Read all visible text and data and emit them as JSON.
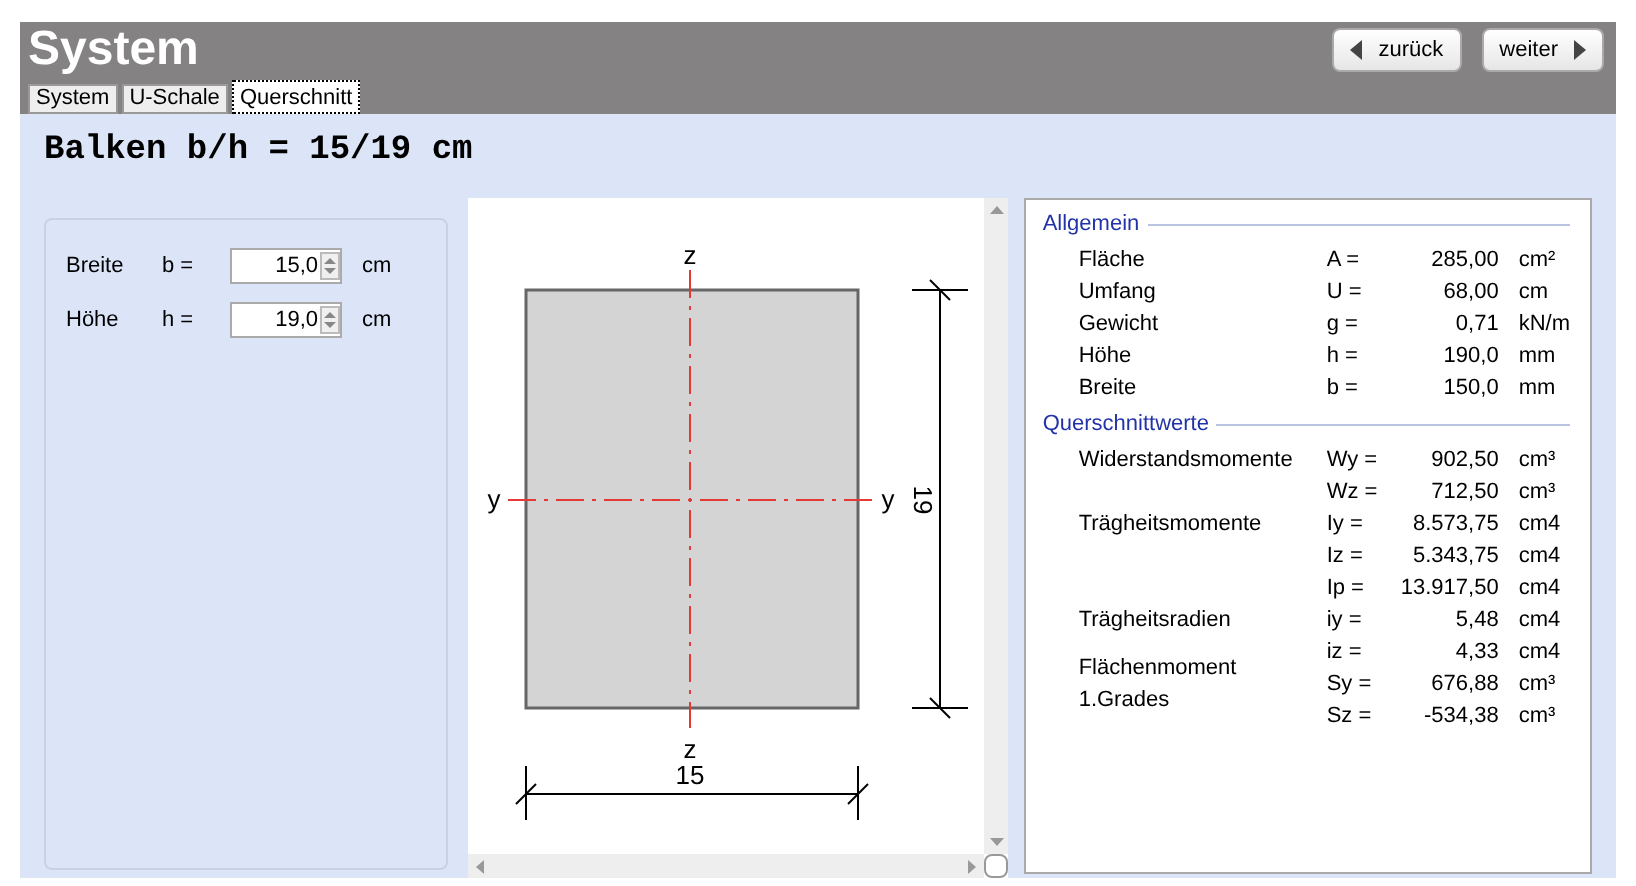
{
  "header": {
    "title": "System",
    "buttons": [
      {
        "kind": "back",
        "label": "zurück"
      },
      {
        "kind": "next",
        "label": "weiter"
      }
    ]
  },
  "tabs": [
    {
      "label": "System",
      "selected": false
    },
    {
      "label": "U-Schale",
      "selected": false
    },
    {
      "label": "Querschnitt",
      "selected": true
    }
  ],
  "heading": "Balken b/h = 15/19 cm",
  "inputs": [
    {
      "label": "Breite",
      "symbol": "b =",
      "value": "15,0",
      "unit": "cm"
    },
    {
      "label": "Höhe",
      "symbol": "h =",
      "value": "19,0",
      "unit": "cm"
    }
  ],
  "drawing": {
    "z_top": "z",
    "z_bottom": "z",
    "y_left": "y",
    "y_right": "y",
    "height_dimension": "19",
    "width_dimension": "15"
  },
  "results": [
    {
      "title": "Allgemein",
      "rows": [
        {
          "label": "Fläche",
          "symbol": "A =",
          "value": "285,00",
          "unit": "cm²"
        },
        {
          "label": "Umfang",
          "symbol": "U =",
          "value": "68,00",
          "unit": "cm"
        },
        {
          "label": "Gewicht",
          "symbol": "g =",
          "value": "0,71",
          "unit": "kN/m"
        },
        {
          "label": "Höhe",
          "symbol": "h =",
          "value": "190,0",
          "unit": "mm"
        },
        {
          "label": "Breite",
          "symbol": "b =",
          "value": "150,0",
          "unit": "mm"
        }
      ]
    },
    {
      "title": "Querschnittwerte",
      "rows": [
        {
          "label": "Widerstandsmomente",
          "symbol": "Wy =",
          "value": "902,50",
          "unit": "cm³"
        },
        {
          "symbol": "Wz =",
          "value": "712,50",
          "unit": "cm³"
        },
        {
          "label": "Trägheitsmomente",
          "symbol": "Iy =",
          "value": "8.573,75",
          "unit": "cm4"
        },
        {
          "symbol": "Iz =",
          "value": "5.343,75",
          "unit": "cm4"
        },
        {
          "symbol": "Ip =",
          "value": "13.917,50",
          "unit": "cm4"
        },
        {
          "label": "Trägheitsradien",
          "symbol": "iy =",
          "value": "5,48",
          "unit": "cm4"
        },
        {
          "symbol": "iz =",
          "value": "4,33",
          "unit": "cm4"
        },
        {
          "label": "Flächenmoment 1.Grades",
          "symbol": "Sy =",
          "value": "676,88",
          "unit": "cm³"
        },
        {
          "symbol": "Sz =",
          "value": "-534,38",
          "unit": "cm³"
        }
      ]
    }
  ]
}
